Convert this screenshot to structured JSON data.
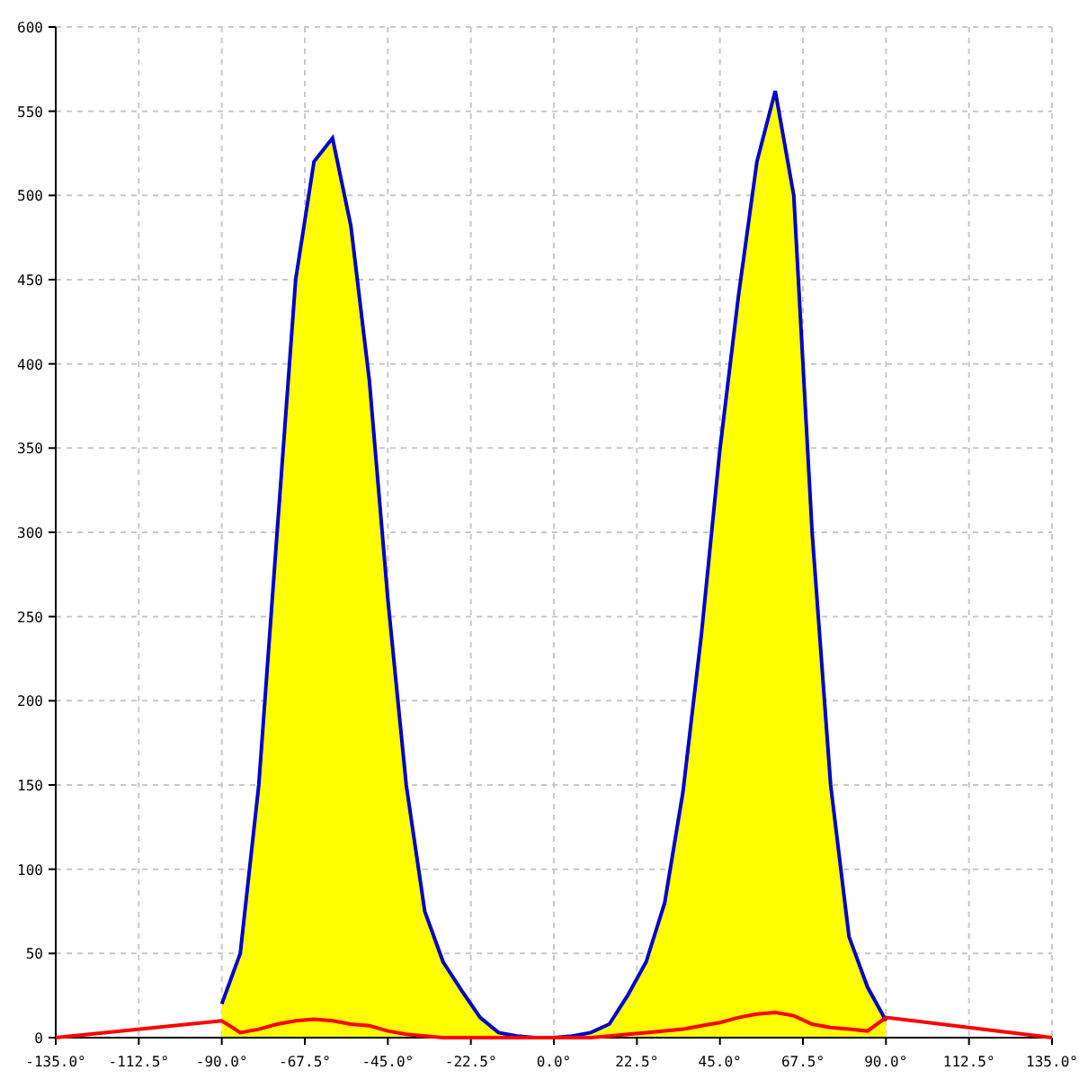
{
  "chart_data": {
    "type": "area",
    "x": [
      -135,
      -90,
      -85,
      -80,
      -75,
      -70,
      -65,
      -60,
      -55,
      -50,
      -45,
      -40,
      -35,
      -30,
      -25,
      -20,
      -15,
      -10,
      -5,
      0,
      5,
      10,
      15,
      20,
      25,
      30,
      35,
      40,
      45,
      50,
      55,
      60,
      65,
      70,
      75,
      80,
      85,
      90,
      135
    ],
    "series": [
      {
        "type": "area",
        "color": "#ffff00",
        "values": [
          null,
          20,
          50,
          150,
          300,
          450,
          520,
          534,
          482,
          390,
          260,
          150,
          75,
          45,
          28,
          12,
          3,
          1,
          0,
          0,
          1,
          3,
          8,
          25,
          45,
          80,
          146,
          240,
          349,
          440,
          520,
          562,
          500,
          300,
          150,
          60,
          30,
          10,
          null
        ]
      },
      {
        "type": "line",
        "color": "#ff0000",
        "values": [
          0,
          10,
          3,
          5,
          8,
          10,
          11,
          10,
          8,
          7,
          4,
          2,
          1,
          0,
          0,
          0,
          0,
          0,
          0,
          0,
          0,
          0,
          1,
          2,
          3,
          4,
          5,
          7,
          9,
          12,
          14,
          15,
          13,
          8,
          6,
          5,
          4,
          12,
          0
        ]
      }
    ],
    "grid": true,
    "xlim": [
      -135,
      135
    ],
    "ylim": [
      0,
      600
    ],
    "xticks": [
      {
        "value": -135,
        "label": "-135.0°"
      },
      {
        "value": -112.5,
        "label": "-112.5°"
      },
      {
        "value": -90,
        "label": "-90.0°"
      },
      {
        "value": -67.5,
        "label": "-67.5°"
      },
      {
        "value": -45,
        "label": "-45.0°"
      },
      {
        "value": -22.5,
        "label": "-22.5°"
      },
      {
        "value": 0,
        "label": "0.0°"
      },
      {
        "value": 22.5,
        "label": "22.5°"
      },
      {
        "value": 45,
        "label": "45.0°"
      },
      {
        "value": 67.5,
        "label": "67.5°"
      },
      {
        "value": 90,
        "label": "90.0°"
      },
      {
        "value": 112.5,
        "label": "112.5°"
      },
      {
        "value": 135,
        "label": "135.0°"
      }
    ],
    "yticks": [
      {
        "value": 0,
        "label": "0"
      },
      {
        "value": 50,
        "label": "50"
      },
      {
        "value": 100,
        "label": "100"
      },
      {
        "value": 150,
        "label": "150"
      },
      {
        "value": 200,
        "label": "200"
      },
      {
        "value": 250,
        "label": "250"
      },
      {
        "value": 300,
        "label": "300"
      },
      {
        "value": 350,
        "label": "350"
      },
      {
        "value": 400,
        "label": "400"
      },
      {
        "value": 450,
        "label": "450"
      },
      {
        "value": 500,
        "label": "500"
      },
      {
        "value": 550,
        "label": "550"
      },
      {
        "value": 600,
        "label": "600"
      }
    ]
  }
}
